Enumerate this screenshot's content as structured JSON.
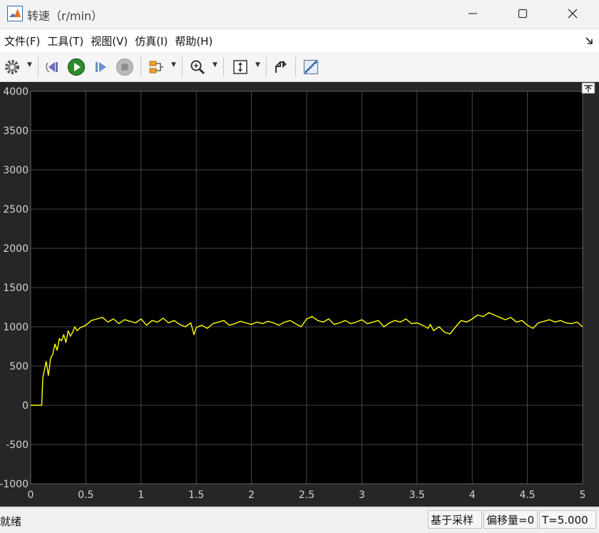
{
  "window": {
    "title": "转速（r/min）"
  },
  "menu": {
    "file": "文件(F)",
    "tools": "工具(T)",
    "view": "视图(V)",
    "simulation": "仿真(I)",
    "help": "帮助(H)"
  },
  "toolbar": {
    "icons": [
      "gear-icon",
      "step-back-icon",
      "run-icon",
      "step-forward-icon",
      "stop-icon",
      "signal-select-icon",
      "zoom-icon",
      "autoscale-icon",
      "highlight-block-icon",
      "measurements-icon"
    ]
  },
  "status": {
    "ready": "就绪",
    "sample_based": "基于采样",
    "offset": "偏移量=0",
    "time": "T=5.000"
  },
  "colors": {
    "plot_background": "#000000",
    "figure_background": "#262626",
    "trace": "#ffff00",
    "grid": "#5a5a5a",
    "tick_text": "#d4d4d4"
  },
  "chart_data": {
    "type": "line",
    "title": "",
    "xlabel": "",
    "ylabel": "",
    "xlim": [
      0,
      5
    ],
    "ylim": [
      -1000,
      4000
    ],
    "xticks": [
      0,
      0.5,
      1,
      1.5,
      2,
      2.5,
      3,
      3.5,
      4,
      4.5,
      5
    ],
    "xtick_labels": [
      "0",
      "0.5",
      "1",
      "1.5",
      "2",
      "2.5",
      "3",
      "3.5",
      "4",
      "4.5",
      "5"
    ],
    "yticks": [
      -1000,
      -500,
      0,
      500,
      1000,
      1500,
      2000,
      2500,
      3000,
      3500,
      4000
    ],
    "ytick_labels": [
      "-1000",
      "-500",
      "0",
      "500",
      "1000",
      "1500",
      "2000",
      "2500",
      "3000",
      "3500",
      "4000"
    ],
    "grid": true,
    "legend": "none",
    "series": [
      {
        "x": [
          0,
          0.05,
          0.1,
          0.11,
          0.12,
          0.14,
          0.16,
          0.17,
          0.18,
          0.2,
          0.22,
          0.24,
          0.26,
          0.28,
          0.3,
          0.32,
          0.34,
          0.36,
          0.38,
          0.4,
          0.42,
          0.45,
          0.5,
          0.55,
          0.6,
          0.65,
          0.7,
          0.75,
          0.8,
          0.85,
          0.9,
          0.95,
          1.0,
          1.05,
          1.1,
          1.15,
          1.2,
          1.25,
          1.3,
          1.35,
          1.4,
          1.45,
          1.48,
          1.5,
          1.55,
          1.6,
          1.65,
          1.7,
          1.75,
          1.8,
          1.85,
          1.9,
          1.95,
          2.0,
          2.05,
          2.1,
          2.15,
          2.2,
          2.25,
          2.3,
          2.35,
          2.4,
          2.45,
          2.5,
          2.55,
          2.6,
          2.65,
          2.7,
          2.75,
          2.8,
          2.85,
          2.9,
          2.95,
          3.0,
          3.05,
          3.1,
          3.15,
          3.2,
          3.25,
          3.3,
          3.35,
          3.4,
          3.45,
          3.5,
          3.55,
          3.6,
          3.62,
          3.65,
          3.7,
          3.75,
          3.8,
          3.85,
          3.9,
          3.95,
          4.0,
          4.05,
          4.1,
          4.15,
          4.2,
          4.25,
          4.3,
          4.35,
          4.4,
          4.45,
          4.5,
          4.55,
          4.6,
          4.65,
          4.7,
          4.75,
          4.8,
          4.85,
          4.9,
          4.95,
          5.0
        ],
        "y": [
          0,
          0,
          0,
          350,
          420,
          560,
          380,
          480,
          600,
          650,
          780,
          700,
          850,
          820,
          900,
          800,
          950,
          880,
          930,
          1000,
          950,
          990,
          1020,
          1080,
          1100,
          1120,
          1060,
          1100,
          1040,
          1090,
          1070,
          1050,
          1100,
          1020,
          1080,
          1060,
          1110,
          1050,
          1080,
          1030,
          1000,
          1050,
          900,
          990,
          1020,
          980,
          1040,
          1060,
          1080,
          1020,
          1040,
          1070,
          1050,
          1030,
          1060,
          1040,
          1070,
          1050,
          1020,
          1060,
          1080,
          1040,
          1000,
          1100,
          1130,
          1080,
          1060,
          1100,
          1030,
          1050,
          1080,
          1040,
          1060,
          1090,
          1040,
          1060,
          1080,
          1000,
          1050,
          1080,
          1060,
          1100,
          1040,
          1050,
          1020,
          980,
          1030,
          950,
          1000,
          930,
          910,
          1000,
          1080,
          1060,
          1100,
          1150,
          1130,
          1180,
          1150,
          1120,
          1090,
          1120,
          1060,
          1080,
          1020,
          980,
          1050,
          1070,
          1090,
          1060,
          1080,
          1050,
          1040,
          1060,
          1000
        ]
      }
    ]
  }
}
